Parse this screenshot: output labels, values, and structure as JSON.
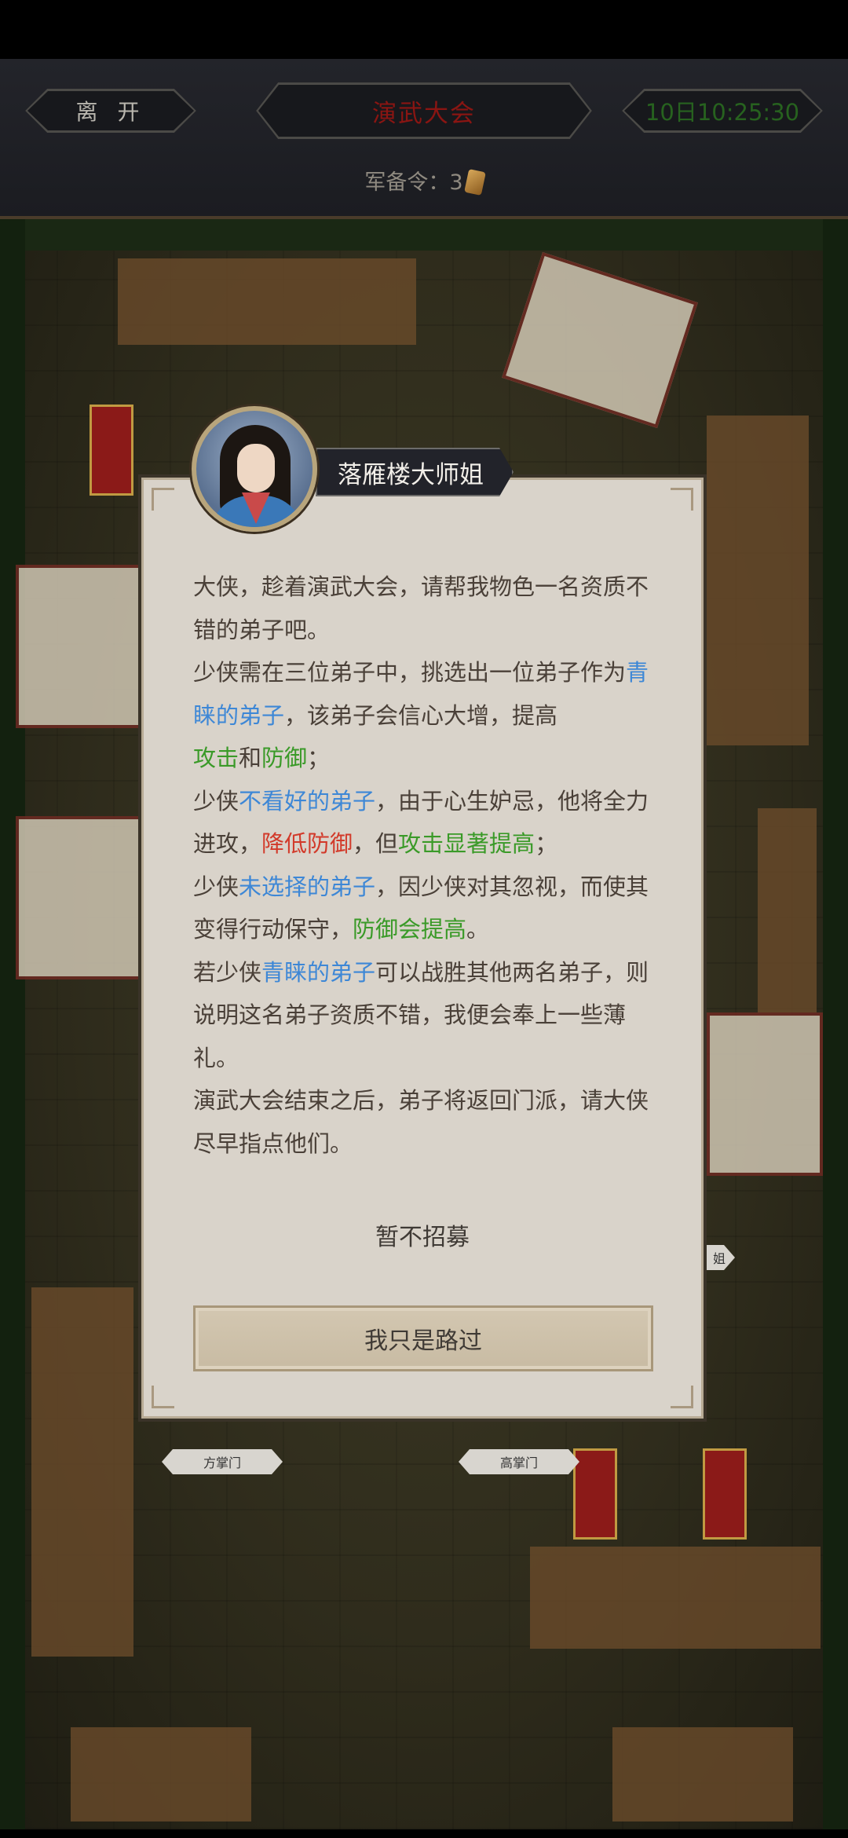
{
  "header": {
    "leave_label": "离 开",
    "title": "演武大会",
    "timer": "10日10:25:30",
    "order_label": "军备令：",
    "order_count": "3"
  },
  "map": {
    "plaque_left": "方掌门",
    "plaque_right": "高掌门",
    "plaque_partial": "姐"
  },
  "dialog": {
    "speaker": "落雁楼大师姐",
    "lines": {
      "l1": "大侠，趁着演武大会，请帮我物色一名资质不错的弟子吧。",
      "l2a": "少侠需在三位弟子中，挑选出一位弟子作为",
      "l2b": "青睐的弟子",
      "l2c": "，该弟子会信心大增，提高",
      "l2d": "攻击",
      "l2e": "和",
      "l2f": "防御",
      "l2g": "；",
      "l3a": "少侠",
      "l3b": "不看好的弟子",
      "l3c": "，由于心生妒忌，他将全力进攻，",
      "l3d": "降低防御",
      "l3e": "，但",
      "l3f": "攻击显著提高",
      "l3g": "；",
      "l4a": "少侠",
      "l4b": "未选择的弟子",
      "l4c": "，因少侠对其忽视，而使其变得行动保守，",
      "l4d": "防御会提高",
      "l4e": "。",
      "l5a": "若少侠",
      "l5b": "青睐的弟子",
      "l5c": "可以战胜其他两名弟子，则说明这名弟子资质不错，我便会奉上一些薄礼。",
      "l6": "演武大会结束之后，弟子将返回门派，请大侠尽早指点他们。"
    },
    "decline_label": "暂不招募",
    "pass_label": "我只是路过"
  },
  "colors": {
    "highlight_blue": "#3d87d6",
    "highlight_green": "#3a9a28",
    "highlight_red": "#d23a2a",
    "title_red": "#8a1512",
    "timer_green": "#27621f"
  }
}
